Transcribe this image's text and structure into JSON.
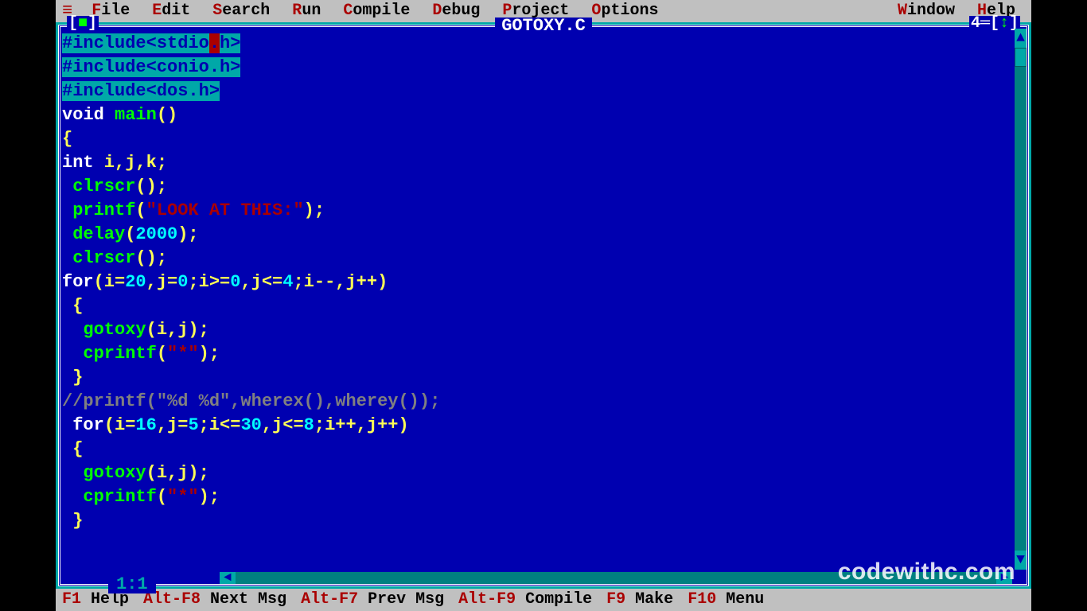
{
  "menubar": {
    "icon": "≡",
    "items": [
      {
        "hotkey": "F",
        "rest": "ile"
      },
      {
        "hotkey": "E",
        "rest": "dit"
      },
      {
        "hotkey": "S",
        "rest": "earch"
      },
      {
        "hotkey": "R",
        "rest": "un"
      },
      {
        "hotkey": "C",
        "rest": "ompile"
      },
      {
        "hotkey": "D",
        "rest": "ebug"
      },
      {
        "hotkey": "P",
        "rest": "roject"
      },
      {
        "hotkey": "O",
        "rest": "ptions"
      }
    ],
    "items_right": [
      {
        "hotkey": "W",
        "rest": "indow"
      },
      {
        "hotkey": "H",
        "rest": "elp"
      }
    ]
  },
  "frame": {
    "title": "GOTOXY.C",
    "window_number": "4",
    "cursor_pos": "1:1",
    "left_control_open": "[",
    "left_control_close": "]",
    "left_control_square": "■",
    "right_control_arrow": "↕"
  },
  "code": {
    "lines": [
      {
        "type": "include_cursor",
        "t1": "#include<stdio",
        "cursor": ".",
        "t2": "h>"
      },
      {
        "type": "include",
        "text": "#include<conio.h>"
      },
      {
        "type": "include",
        "text": "#include<dos.h>"
      },
      {
        "type": "sig",
        "kw": "void",
        "sp": " ",
        "fn": "main",
        "paren": "()"
      },
      {
        "type": "brace",
        "text": "{"
      },
      {
        "type": "decl",
        "kw": "int",
        "rest": " i,j,k;"
      },
      {
        "type": "call",
        "indent": " ",
        "fn": "clrscr",
        "args": "();"
      },
      {
        "type": "printf",
        "indent": " ",
        "fn": "printf",
        "open": "(",
        "str": "\"LOOK AT THIS:\"",
        "close": ");"
      },
      {
        "type": "call_num",
        "indent": " ",
        "fn": "delay",
        "open": "(",
        "num": "2000",
        "close": ");"
      },
      {
        "type": "call",
        "indent": " ",
        "fn": "clrscr",
        "args": "();"
      },
      {
        "type": "for",
        "kw": "for",
        "open": "(i=",
        "n1": "20",
        "mid1": ",j=",
        "n2": "0",
        "mid2": ";i>=",
        "n3": "0",
        "mid3": ",j<=",
        "n4": "4",
        "mid4": ";i--,j++)"
      },
      {
        "type": "brace_indent",
        "text": " {"
      },
      {
        "type": "call",
        "indent": "  ",
        "fn": "gotoxy",
        "args": "(i,j);"
      },
      {
        "type": "printf",
        "indent": "  ",
        "fn": "cprintf",
        "open": "(",
        "str": "\"*\"",
        "close": ");"
      },
      {
        "type": "brace_indent",
        "text": " }"
      },
      {
        "type": "comment",
        "text": "//printf(\"%d %d\",wherex(),wherey());"
      },
      {
        "type": "for",
        "indent": " ",
        "kw": "for",
        "open": "(i=",
        "n1": "16",
        "mid1": ",j=",
        "n2": "5",
        "mid2": ";i<=",
        "n3": "30",
        "mid3": ",j<=",
        "n4": "8",
        "mid4": ";i++,j++)"
      },
      {
        "type": "brace_indent",
        "text": " {"
      },
      {
        "type": "call",
        "indent": "  ",
        "fn": "gotoxy",
        "args": "(i,j);"
      },
      {
        "type": "printf",
        "indent": "  ",
        "fn": "cprintf",
        "open": "(",
        "str": "\"*\"",
        "close": ");"
      },
      {
        "type": "brace_indent",
        "text": " }"
      }
    ]
  },
  "statusbar": {
    "items": [
      {
        "hk": "F1",
        "label": " Help"
      },
      {
        "hk": "Alt-F8",
        "label": " Next Msg"
      },
      {
        "hk": "Alt-F7",
        "label": " Prev Msg"
      },
      {
        "hk": "Alt-F9",
        "label": " Compile"
      },
      {
        "hk": "F9",
        "label": " Make"
      },
      {
        "hk": "F10",
        "label": " Menu"
      }
    ]
  },
  "watermark": "codewithc.com",
  "scroll": {
    "up": "▲",
    "down": "▼",
    "left": "◄",
    "right": "►"
  }
}
